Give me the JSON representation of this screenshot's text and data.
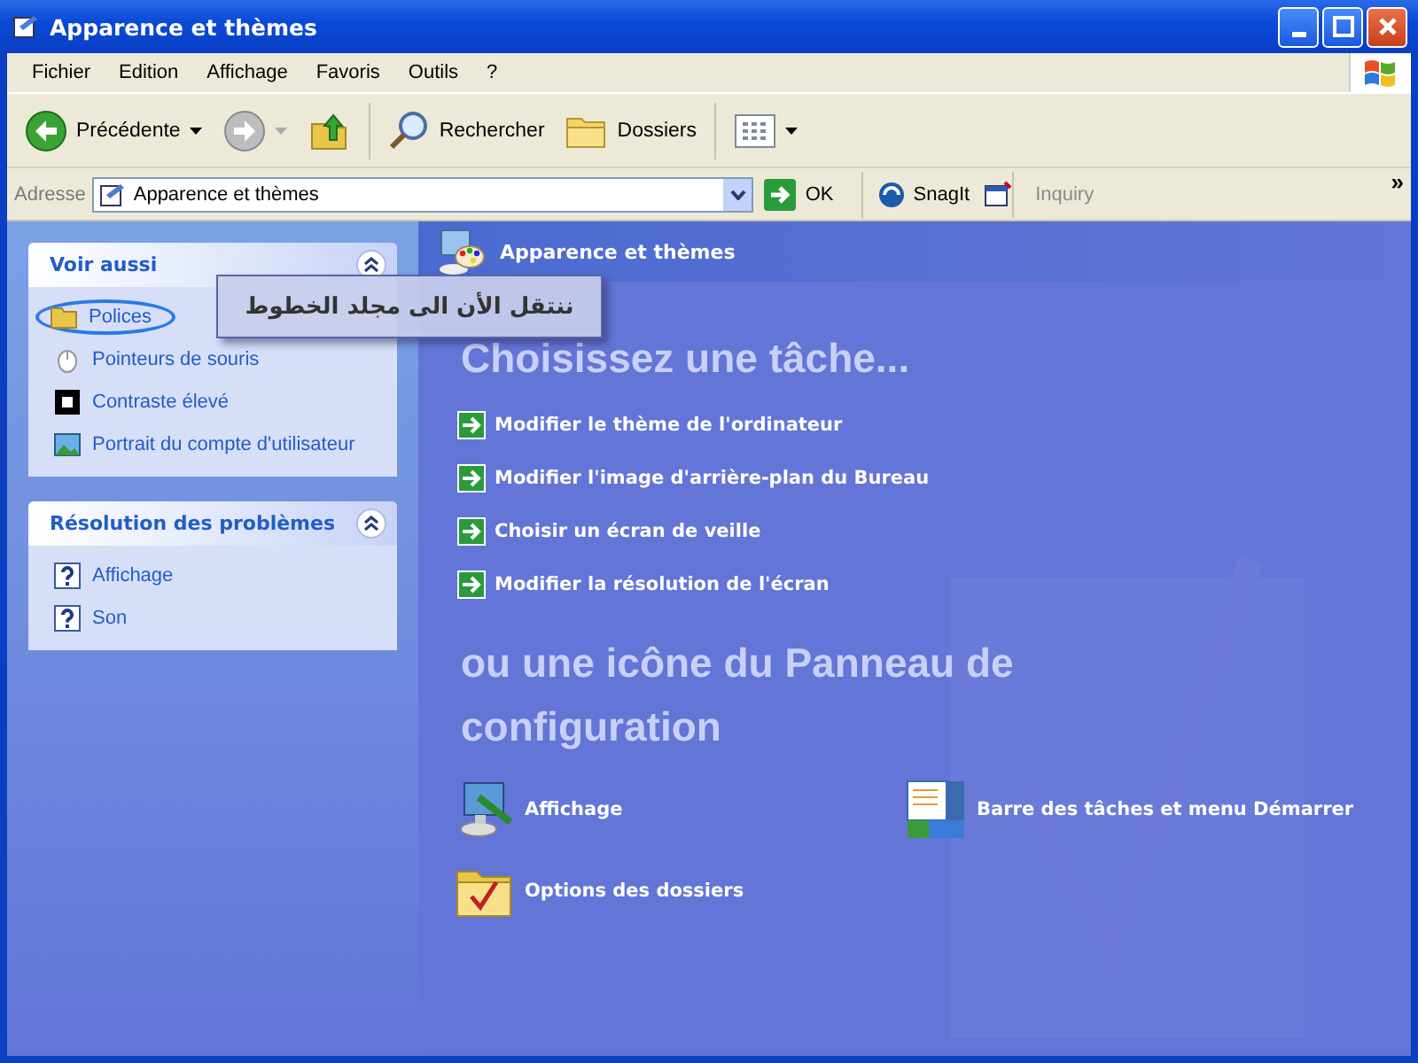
{
  "window": {
    "title": "Apparence et thèmes"
  },
  "menu_bar": [
    "Fichier",
    "Edition",
    "Affichage",
    "Favoris",
    "Outils",
    "?"
  ],
  "toolbar": [
    {
      "kind": "back",
      "label": "Précédente",
      "dropdown": true
    },
    {
      "kind": "forward",
      "dropdown": true
    },
    {
      "kind": "up",
      "dropdown": false
    },
    {
      "kind": "search",
      "label": "Rechercher",
      "dropdown": false
    },
    {
      "kind": "folders",
      "label": "Dossiers",
      "dropdown": false
    },
    {
      "kind": "views",
      "dropdown": true
    }
  ],
  "address_bar": {
    "label": "Adresse",
    "value": "Apparence et thèmes",
    "go_label": "OK"
  },
  "links_bar": {
    "snagit": "SnagIt",
    "inquiry": "Inquiry",
    "more": "»"
  },
  "sidebar": [
    {
      "title": "Voir aussi",
      "expanded": true,
      "items": [
        {
          "label": "Polices",
          "kind": "folder",
          "circled": true
        },
        {
          "label": "Pointeurs de souris",
          "kind": "mouse",
          "circled": false
        },
        {
          "label": "Contraste élevé",
          "kind": "contrast",
          "circled": false
        },
        {
          "label": "Portrait du compte d'utilisateur",
          "kind": "picture",
          "circled": false
        }
      ]
    },
    {
      "title": "Résolution des problèmes",
      "expanded": true,
      "items": [
        {
          "label": "Affichage",
          "kind": "help",
          "circled": false
        },
        {
          "label": "Son",
          "kind": "help",
          "circled": false
        }
      ]
    }
  ],
  "callout": {
    "text": "ننتقل الأن الى مجلد الخطوط"
  },
  "main": {
    "header": "Apparence et thèmes",
    "task_heading": "Choisissez une tâche...",
    "tasks": [
      "Modifier le thème de l'ordinateur",
      "Modifier l'image d'arrière-plan du Bureau",
      "Choisir un écran de veille",
      "Modifier la résolution de l'écran"
    ],
    "icons_heading": "ou une icône du Panneau de configuration",
    "icons": [
      {
        "label": "Affichage",
        "kind": "display"
      },
      {
        "label": "Barre des tâches et menu Démarrer",
        "kind": "taskbar"
      },
      {
        "label": "Options des dossiers",
        "kind": "folder-check"
      }
    ]
  }
}
